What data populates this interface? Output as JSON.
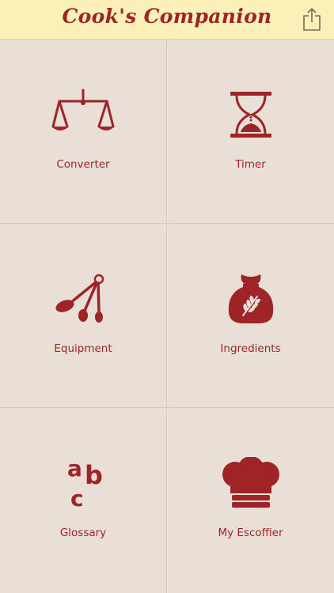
{
  "header": {
    "title": "Cook's Companion",
    "share_icon": "share-icon"
  },
  "colors": {
    "accent": "#9e2427",
    "header_bg": "#fbf0b7",
    "background": "#e9dfd6",
    "divider": "#d6cbc0"
  },
  "tiles": [
    {
      "label": "Converter",
      "icon": "scale-icon"
    },
    {
      "label": "Timer",
      "icon": "hourglass-icon"
    },
    {
      "label": "Equipment",
      "icon": "measuring-spoons-icon"
    },
    {
      "label": "Ingredients",
      "icon": "flour-sack-icon"
    },
    {
      "label": "Glossary",
      "icon": "abc-icon"
    },
    {
      "label": "My Escoffier",
      "icon": "chef-hat-icon"
    }
  ]
}
